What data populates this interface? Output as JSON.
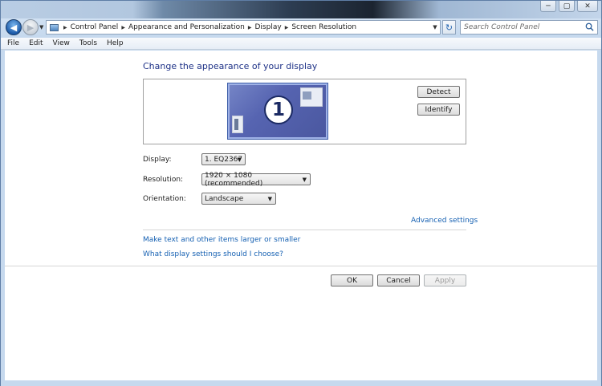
{
  "window": {
    "caption_buttons": {
      "minimize": "─",
      "maximize": "▢",
      "close": "✕"
    }
  },
  "nav": {
    "back_icon": "◀",
    "forward_icon": "▶",
    "recent_icon": "▼",
    "breadcrumb": [
      "Control Panel",
      "Appearance and Personalization",
      "Display",
      "Screen Resolution"
    ],
    "crumb_sep": "▶",
    "address_dropdown": "▼",
    "refresh_icon": "↻",
    "search_placeholder": "Search Control Panel"
  },
  "menu": [
    "File",
    "Edit",
    "View",
    "Tools",
    "Help"
  ],
  "content": {
    "title": "Change the appearance of your display",
    "monitor_number": "1",
    "detect_label": "Detect",
    "identify_label": "Identify",
    "display_label": "Display:",
    "display_value": "1. EQ2367",
    "resolution_label": "Resolution:",
    "resolution_value": "1920 × 1080 (recommended)",
    "orientation_label": "Orientation:",
    "orientation_value": "Landscape",
    "dropdown_arrow": "▼",
    "advanced_link": "Advanced settings",
    "text_size_link": "Make text and other items larger or smaller",
    "help_link": "What display settings should I choose?",
    "ok_label": "OK",
    "cancel_label": "Cancel",
    "apply_label": "Apply"
  }
}
